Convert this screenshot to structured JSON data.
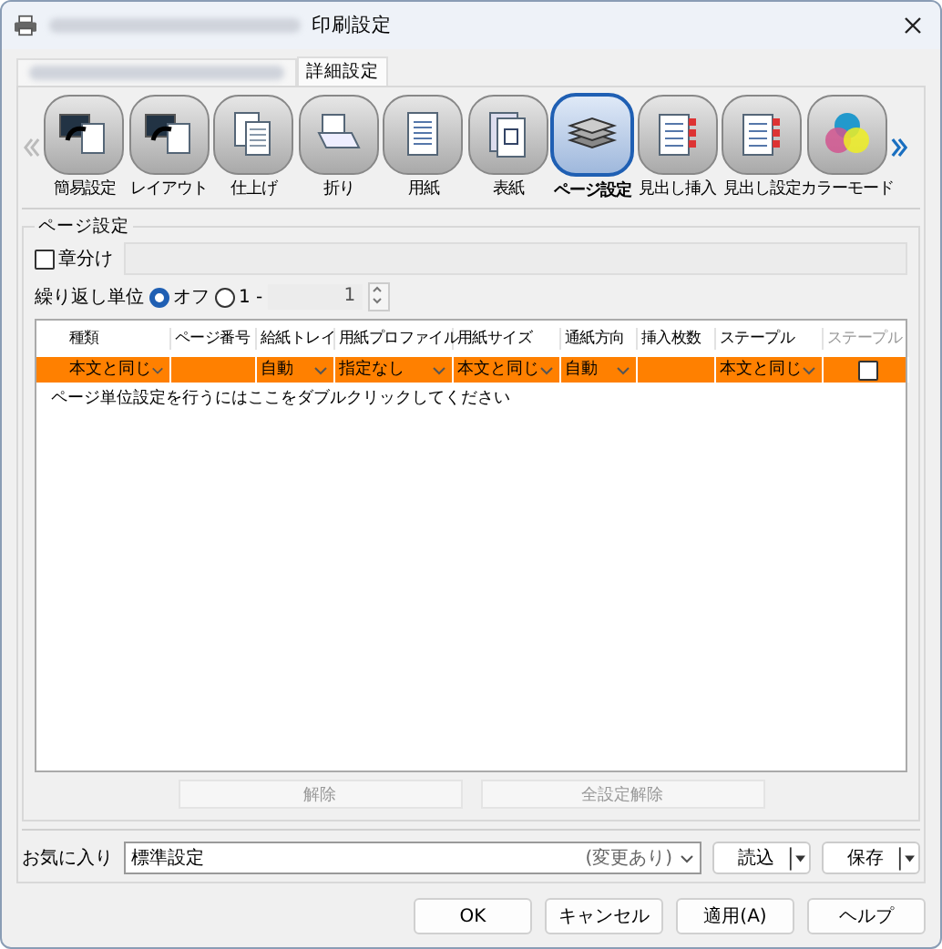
{
  "window": {
    "title": "印刷設定"
  },
  "tabs": [
    {
      "label": "詳細設定",
      "selected": true
    }
  ],
  "toolbar": {
    "items": [
      {
        "label": "簡易設定",
        "kind": "monitor",
        "selected": false
      },
      {
        "label": "レイアウト",
        "kind": "monitor",
        "selected": false
      },
      {
        "label": "仕上げ",
        "kind": "pages",
        "selected": false
      },
      {
        "label": "折り",
        "kind": "fold",
        "selected": false
      },
      {
        "label": "用紙",
        "kind": "paper",
        "selected": false
      },
      {
        "label": "表紙",
        "kind": "cover",
        "selected": false
      },
      {
        "label": "ページ設定",
        "kind": "stack",
        "selected": true
      },
      {
        "label": "見出し挿入",
        "kind": "tabs",
        "selected": false
      },
      {
        "label": "見出し設定",
        "kind": "tabs",
        "selected": false
      },
      {
        "label": "カラーモード",
        "kind": "color",
        "selected": false
      }
    ]
  },
  "page_settings": {
    "title": "ページ設定",
    "chapter": {
      "label": "章分け",
      "checked": false
    },
    "repeat": {
      "label": "繰り返し単位",
      "options": [
        {
          "label": "オフ",
          "selected": true
        },
        {
          "label": "1 -",
          "selected": false
        }
      ],
      "value": "1"
    },
    "table": {
      "columns": [
        {
          "label": "種類",
          "disabled": false
        },
        {
          "label": "ページ番号",
          "disabled": false
        },
        {
          "label": "給紙トレイ",
          "disabled": false
        },
        {
          "label": "用紙プロファイル",
          "disabled": false
        },
        {
          "label": "用紙サイズ",
          "disabled": false
        },
        {
          "label": "通紙方向",
          "disabled": false
        },
        {
          "label": "挿入枚数",
          "disabled": false
        },
        {
          "label": "ステープル",
          "disabled": false
        },
        {
          "label": "ステープル",
          "disabled": true
        }
      ],
      "rows": [
        {
          "cells": [
            {
              "kind": "combo",
              "text": "本文と同じ"
            },
            {
              "kind": "text",
              "text": ""
            },
            {
              "kind": "combo",
              "text": "自動"
            },
            {
              "kind": "combo",
              "text": "指定なし"
            },
            {
              "kind": "combo",
              "text": "本文と同じ"
            },
            {
              "kind": "combo",
              "text": "自動"
            },
            {
              "kind": "text",
              "text": ""
            },
            {
              "kind": "combo",
              "text": "本文と同じ"
            },
            {
              "kind": "check",
              "checked": false
            }
          ]
        }
      ],
      "hint": "ページ単位設定を行うにはここをダブルクリックしてください"
    },
    "buttons": [
      {
        "label": "解除",
        "disabled": true
      },
      {
        "label": "全設定解除",
        "disabled": true
      }
    ]
  },
  "favorites": {
    "label": "お気に入り",
    "value": "標準設定",
    "note": "(変更あり)",
    "load": "読込",
    "save": "保存"
  },
  "buttons": [
    "OK",
    "キャンセル",
    "適用(A)",
    "ヘルプ"
  ]
}
